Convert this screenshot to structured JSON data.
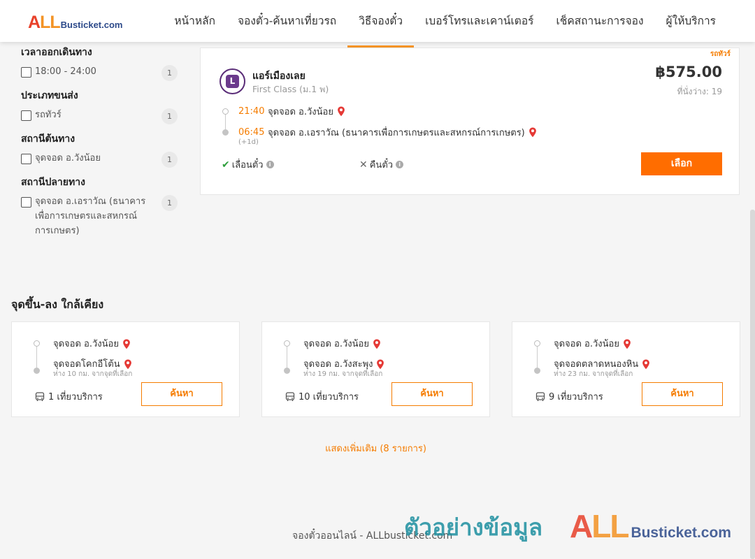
{
  "header": {
    "logo": {
      "all_a": "A",
      "all_ll": "LL",
      "rest": "Busticket.com"
    },
    "nav": [
      {
        "label": "หน้าหลัก"
      },
      {
        "label": "จองตั๋ว-ค้นหาเที่ยวรถ"
      },
      {
        "label": "วิธีจองตั๋ว"
      },
      {
        "label": "เบอร์โทรและเคาน์เตอร์"
      },
      {
        "label": "เช็คสถานะการจอง"
      },
      {
        "label": "ผู้ให้บริการ"
      }
    ],
    "active_nav": "วิธีจองตั๋ว"
  },
  "filters": [
    {
      "title": "เวลาออกเดินทาง",
      "option": "18:00 - 24:00",
      "count": "1"
    },
    {
      "title": "ประเภทขนส่ง",
      "option": "รถทัวร์",
      "count": "1"
    },
    {
      "title": "สถานีต้นทาง",
      "option": "จุดจอด อ.วังน้อย",
      "count": "1"
    },
    {
      "title": "สถานีปลายทาง",
      "option": "จุดจอด อ.เอราวัณ (ธนาคารเพื่อการเกษตรและสหกรณ์การเกษตร)",
      "count": "1"
    }
  ],
  "trip": {
    "ribbon": "รถทัวร์",
    "operator": "แอร์เมืองเลย",
    "class": "First Class (ม.1 พ)",
    "price": "฿575.00",
    "seats": "ที่นั่งว่าง: 19",
    "depart_time": "21:40",
    "depart_place": "จุดจอด อ.วังน้อย",
    "arrive_time": "06:45",
    "arrive_place": "จุดจอด อ.เอราวัณ (ธนาคารเพื่อการเกษตรและสหกรณ์การเกษตร)",
    "plus_day": "(+1d)",
    "reschedule": "เลื่อนตั๋ว",
    "refund": "คืนตั๋ว",
    "select": "เลือก"
  },
  "nearby": {
    "title": "จุดขึ้น-ลง ใกล้เคียง",
    "cards": [
      {
        "from": "จุดจอด อ.วังน้อย",
        "to": "จุดจอดโคกอีโต้น",
        "dist": "ห่าง 10 กม. จากจุดที่เลือก",
        "trips": "1 เที่ยวบริการ",
        "button": "ค้นหา"
      },
      {
        "from": "จุดจอด อ.วังน้อย",
        "to": "จุดจอด อ.วังสะพุง",
        "dist": "ห่าง 19 กม. จากจุดที่เลือก",
        "trips": "10 เที่ยวบริการ",
        "button": "ค้นหา"
      },
      {
        "from": "จุดจอด อ.วังน้อย",
        "to": "จุดจอดตลาดหนองหิน",
        "dist": "ห่าง 23 กม. จากจุดที่เลือก",
        "trips": "9 เที่ยวบริการ",
        "button": "ค้นหา"
      }
    ],
    "show_more": "แสดงเพิ่มเติม (8 รายการ)"
  },
  "footer": {
    "text": "จองตั๋วออนไลน์ - ALLbusticket.com"
  },
  "watermark": {
    "sample": "ตัวอย่างข้อมูล",
    "all_a": "A",
    "all_ll": "LL",
    "rest": "Busticket.com"
  },
  "colors": {
    "accent": "#ff6d00",
    "link": "#f57c00",
    "pin": "#e53935"
  },
  "icons": {
    "pin": "map-pin-icon",
    "bus": "bus-icon",
    "check": "check-icon",
    "cross": "cross-icon",
    "info": "info-icon"
  }
}
